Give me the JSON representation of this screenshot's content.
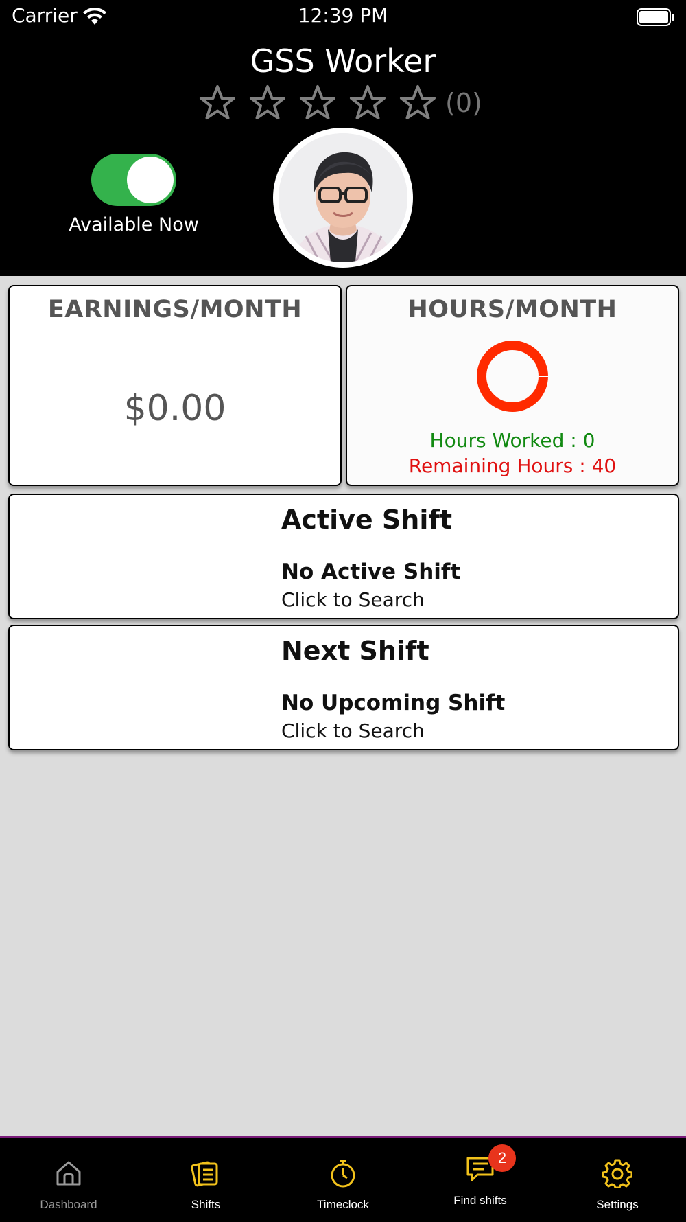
{
  "status_bar": {
    "carrier": "Carrier",
    "time": "12:39 PM"
  },
  "header": {
    "title": "GSS Worker",
    "rating": {
      "stars": 0,
      "max_stars": 5,
      "count_label": "(0)"
    },
    "availability": {
      "label": "Available Now",
      "toggle_on": true,
      "toggle_color": "#34b24c"
    }
  },
  "earnings": {
    "heading": "EARNINGS/MONTH",
    "value": "$0.00"
  },
  "hours": {
    "heading": "HOURS/MONTH",
    "worked_label": "Hours Worked : 0",
    "remaining_label": "Remaining Hours : 40",
    "worked": 0,
    "remaining": 40,
    "worked_color": "#128a12",
    "remaining_color": "#e01010"
  },
  "active_shift": {
    "title": "Active Shift",
    "status": "No Active Shift",
    "action": "Click to Search"
  },
  "next_shift": {
    "title": "Next Shift",
    "status": "No Upcoming Shift",
    "action": "Click to Search"
  },
  "tab_bar": {
    "accent_color": "#f2c21b",
    "tabs": [
      {
        "label": "Dashboard",
        "icon": "home-icon",
        "active": false
      },
      {
        "label": "Shifts",
        "icon": "document-stack-icon",
        "active": true
      },
      {
        "label": "Timeclock",
        "icon": "stopwatch-icon",
        "active": true
      },
      {
        "label": "Find shifts",
        "icon": "chat-bubble-icon",
        "active": true,
        "badge": "2"
      },
      {
        "label": "Settings",
        "icon": "gear-icon",
        "active": true
      }
    ]
  }
}
